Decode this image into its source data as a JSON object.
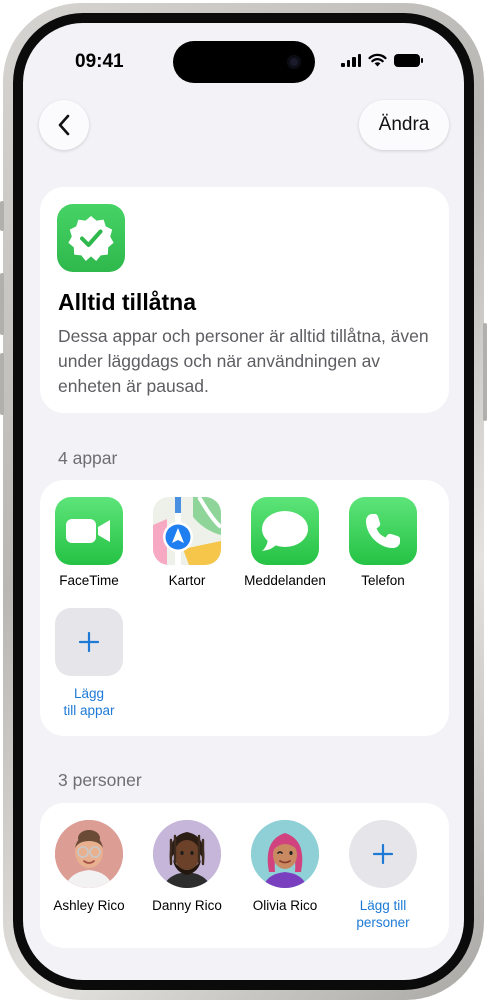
{
  "status_bar": {
    "time": "09:41"
  },
  "nav": {
    "edit_label": "Ändra"
  },
  "header_card": {
    "title": "Alltid tillåtna",
    "description": "Dessa appar och personer är alltid tillåtna, även under läggdags och när användningen av enheten är pausad."
  },
  "apps_section": {
    "label": "4 appar",
    "apps": [
      {
        "label": "FaceTime",
        "icon": "facetime-icon"
      },
      {
        "label": "Kartor",
        "icon": "maps-icon"
      },
      {
        "label": "Meddelanden",
        "icon": "messages-icon"
      },
      {
        "label": "Telefon",
        "icon": "phone-icon"
      }
    ],
    "add_line1": "Lägg",
    "add_line2": "till appar"
  },
  "people_section": {
    "label": "3 personer",
    "people": [
      {
        "name": "Ashley Rico"
      },
      {
        "name": "Danny Rico"
      },
      {
        "name": "Olivia Rico"
      }
    ],
    "add_line1": "Lägg till",
    "add_line2": "personer"
  },
  "colors": {
    "accent": "#1e7ad6",
    "green": "#34c759",
    "background": "#f2f2f7"
  }
}
